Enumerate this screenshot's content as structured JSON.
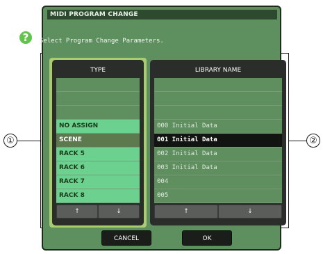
{
  "dialog": {
    "title": "MIDI PROGRAM CHANGE",
    "instruction": "Select Program Change Parameters.",
    "help_icon": "question-mark-icon"
  },
  "callouts": {
    "left": "①",
    "right": "②"
  },
  "type_panel": {
    "header": "TYPE",
    "rows": [
      "",
      "",
      "",
      "NO ASSIGN",
      "SCENE",
      "RACK 5",
      "RACK 6",
      "RACK 7",
      "RACK 8"
    ],
    "selected_row": "SCENE",
    "scroll_up": "↑",
    "scroll_down": "↓"
  },
  "library_panel": {
    "header": "LIBRARY NAME",
    "rows": [
      "",
      "",
      "",
      "000 Initial Data",
      "001 Initial Data",
      "002 Initial Data",
      "003 Initial Data",
      "004",
      "005"
    ],
    "selected_row": "001 Initial Data",
    "scroll_up": "↑",
    "scroll_down": "↓"
  },
  "buttons": {
    "cancel": "CANCEL",
    "ok": "OK"
  },
  "colors": {
    "dialog_bg": "#5e8f5e",
    "type_item": "#6cd08e",
    "selected_library": "#111411",
    "panel_highlight": "#a9cc6e"
  }
}
